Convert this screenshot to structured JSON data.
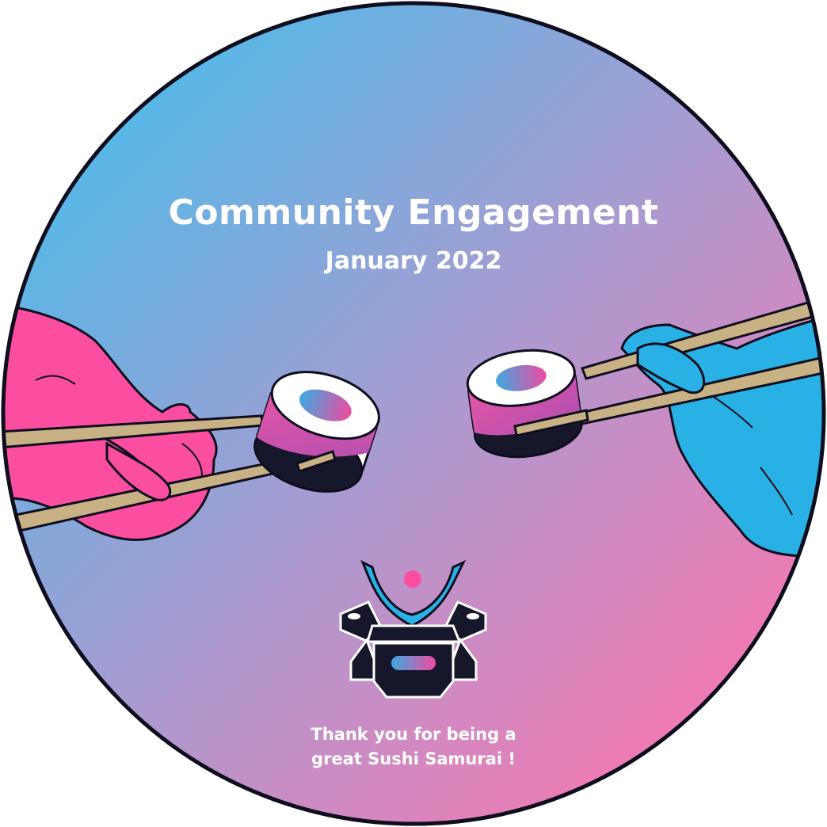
{
  "badge": {
    "title": "Community Engagement",
    "subtitle": "January 2022",
    "message_line1": "Thank you for being a",
    "message_line2": "great Sushi Samurai !"
  },
  "colors": {
    "gradient_start": "#4dbbe9",
    "gradient_end": "#f977b0",
    "pink_hand": "#fb4ea0",
    "blue_hand": "#29b1e6",
    "chopstick": "#c8b285",
    "outline": "#0e0e1f"
  },
  "icons": [
    "pink-hand-icon",
    "blue-hand-icon",
    "sushi-roll-icon",
    "samurai-helmet-logo-icon"
  ]
}
